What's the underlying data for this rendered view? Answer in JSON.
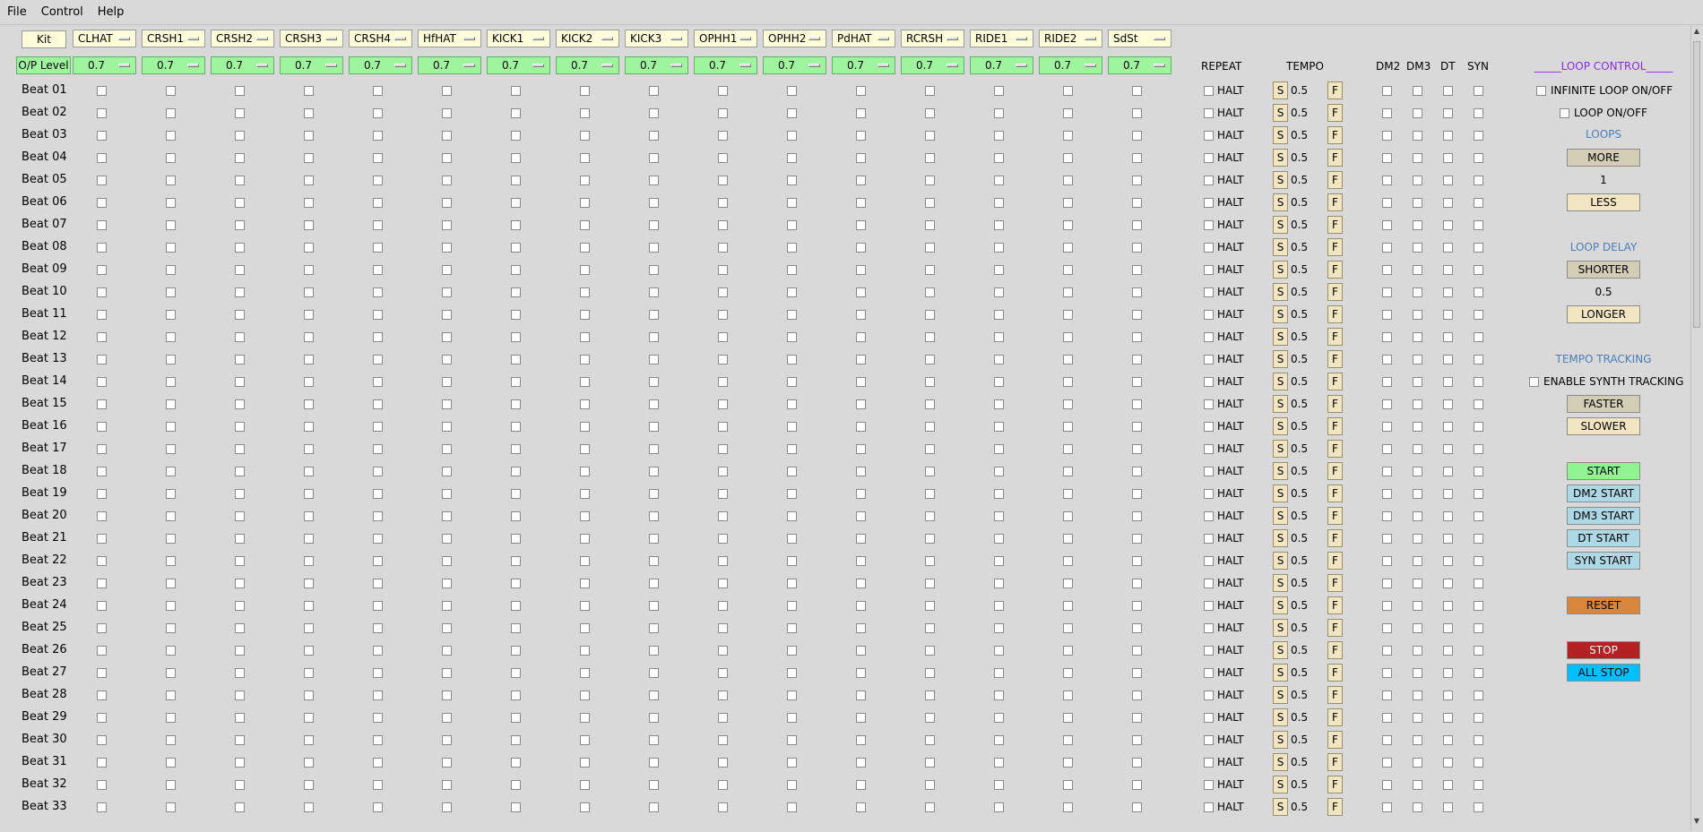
{
  "menu": {
    "file": "File",
    "control": "Control",
    "help": "Help"
  },
  "kit_label": "Kit",
  "op_level_label": "O/P Level",
  "instruments": [
    "CLHAT",
    "CRSH1",
    "CRSH2",
    "CRSH3",
    "CRSH4",
    "HfHAT",
    "KICK1",
    "KICK2",
    "KICK3",
    "OPHH1",
    "OPHH2",
    "PdHAT",
    "RCRSH",
    "RIDE1",
    "RIDE2",
    "SdSt"
  ],
  "levels": [
    "0.7",
    "0.7",
    "0.7",
    "0.7",
    "0.7",
    "0.7",
    "0.7",
    "0.7",
    "0.7",
    "0.7",
    "0.7",
    "0.7",
    "0.7",
    "0.7",
    "0.7",
    "0.7"
  ],
  "headers": {
    "repeat": "REPEAT",
    "tempo": "TEMPO",
    "dm2": "DM2",
    "dm3": "DM3",
    "dt": "DT",
    "syn": "SYN"
  },
  "beats": [
    "Beat 01",
    "Beat 02",
    "Beat 03",
    "Beat 04",
    "Beat 05",
    "Beat 06",
    "Beat 07",
    "Beat 08",
    "Beat 09",
    "Beat 10",
    "Beat 11",
    "Beat 12",
    "Beat 13",
    "Beat 14",
    "Beat 15",
    "Beat 16",
    "Beat 17",
    "Beat 18",
    "Beat 19",
    "Beat 20",
    "Beat 21",
    "Beat 22",
    "Beat 23",
    "Beat 24",
    "Beat 25",
    "Beat 26",
    "Beat 27",
    "Beat 28",
    "Beat 29",
    "Beat 30",
    "Beat 31",
    "Beat 32",
    "Beat 33"
  ],
  "row": {
    "halt": "HALT",
    "slow": "S",
    "tempo_value": "0.5",
    "fast": "F"
  },
  "loop_control": {
    "title": "_____LOOP CONTROL_____",
    "infinite_loop": "INFINITE LOOP ON/OFF",
    "loop_onoff": "LOOP ON/OFF",
    "loops_label": "LOOPS",
    "more": "MORE",
    "loops_value": "1",
    "less": "LESS",
    "delay_label": "LOOP DELAY",
    "shorter": "SHORTER",
    "delay_value": "0.5",
    "longer": "LONGER",
    "tracking_label": "TEMPO TRACKING",
    "enable_tracking": "ENABLE SYNTH TRACKING",
    "faster": "FASTER",
    "slower": "SLOWER",
    "start": "START",
    "dm2_start": "DM2 START",
    "dm3_start": "DM3 START",
    "dt_start": "DT START",
    "syn_start": "SYN START",
    "reset": "RESET",
    "stop": "STOP",
    "all_stop": "ALL STOP"
  },
  "colors": {
    "background": "#d9d9d9",
    "kit_yellow": "#fefcd9",
    "level_green": "#9ef59e",
    "start_green": "#90f490",
    "start_blue": "#add8e6",
    "reset_orange": "#d9853b",
    "stop_red": "#b22222",
    "all_stop_blue": "#00bfff",
    "section_label": "#4a7fb8",
    "title_purple": "#8a2be2",
    "tan_button": "#d2cdb4",
    "cream_button": "#f2e6c2"
  }
}
